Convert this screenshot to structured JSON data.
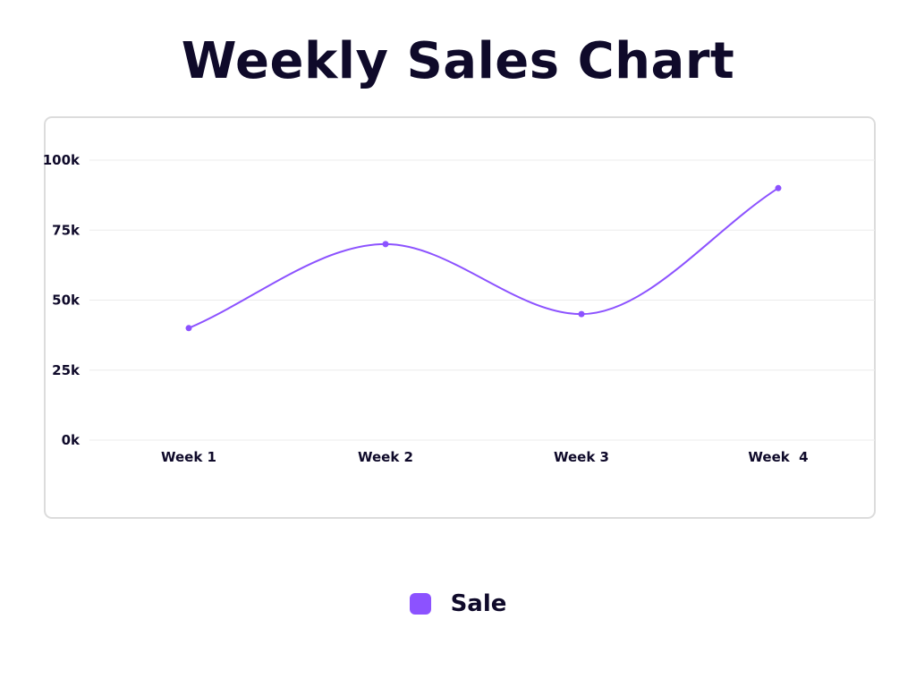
{
  "chart_data": {
    "type": "line",
    "title": "Weekly Sales Chart",
    "categories": [
      "Week 1",
      "Week 2",
      "Week 3",
      "Week  4"
    ],
    "series": [
      {
        "name": "Sale",
        "values": [
          40000,
          70000,
          45000,
          90000
        ],
        "color": "#8c52ff"
      }
    ],
    "ylim": [
      0,
      100000
    ],
    "yticks": [
      {
        "value": 0,
        "label": "0k"
      },
      {
        "value": 25000,
        "label": "25k"
      },
      {
        "value": 50000,
        "label": "50k"
      },
      {
        "value": 75000,
        "label": "75k"
      },
      {
        "value": 100000,
        "label": "100k"
      }
    ],
    "xlabel": "",
    "ylabel": "",
    "grid": true,
    "smooth": true,
    "legend_position": "bottom-center"
  }
}
